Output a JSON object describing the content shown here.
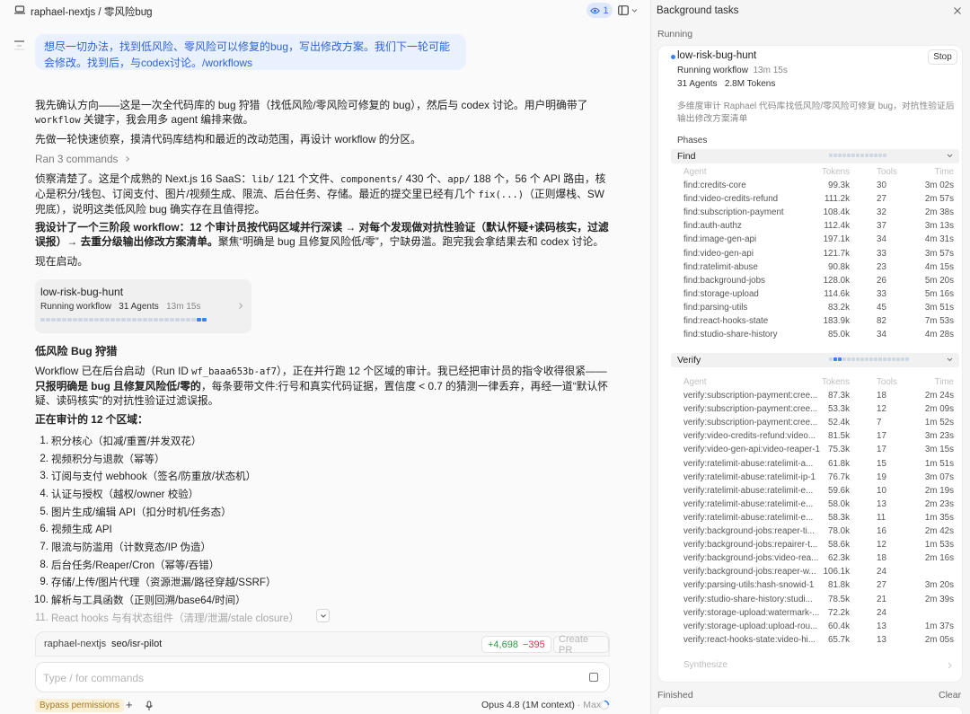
{
  "header": {
    "title": "raphael-nextjs / 零风险bug",
    "agent_count": "1"
  },
  "chat": {
    "user_message": "想尽一切办法，找到低风险、零风险可以修复的bug，写出修改方案。我们下一轮可能会修改。找到后，与codex讨论。/workflows",
    "p1_a": "我先确认方向——这是一次全代码库的 bug 狩猎（找低风险/零风险可修复的 bug），然后与 codex 讨论。用户明确带了 ",
    "p1_code": "workflow",
    "p1_b": " 关键字，我会用多 agent 编排来做。",
    "p2": "先做一轮快速侦察，摸清代码库结构和最近的改动范围，再设计 workflow 的分区。",
    "ran_commands": "Ran 3 commands",
    "p3_a": "侦察清楚了。这是个成熟的 Next.js 16 SaaS：",
    "p3_code1": "lib/",
    "p3_b": " 121 个文件、",
    "p3_code2": "components/",
    "p3_c": " 430 个、",
    "p3_code3": "app/",
    "p3_d": " 188 个，56 个 API 路由，核心是积分/钱包、订阅支付、图片/视频生成、限流、后台任务、存储。最近的提交里已经有几个 ",
    "p3_code4": "fix(...)",
    "p3_e": "（正则爆栈、SW 兜底），说明这类低风险 bug 确实存在且值得挖。",
    "p4_a": "我设计了一个三阶段 workflow：12 个审计员按代码区域并行深读 → 对每个发现做对抗性验证（默认怀疑+读码核实，过滤误报）→ 去重分级输出修改方案清单。",
    "p4_b": "聚焦“明确是 bug 且修复风险低/零”，宁缺毋滥。跑完我会拿结果去和 codex 讨论。",
    "p5": "现在启动。",
    "workflow_card": {
      "name": "low-risk-bug-hunt",
      "status": "Running workflow",
      "agents": "31 Agents",
      "elapsed": "13m 15s",
      "dots_total": 31,
      "dots_active": [
        29,
        30
      ]
    },
    "section_title": "低风险 Bug 狩猎",
    "p6_a": "Workflow 已在后台启动（Run ID ",
    "p6_code": "wf_baaa653b-af7",
    "p6_b": "），正在并行跑 12 个区域的审计。我已经把审计员的指令收得很紧——",
    "p6_bold": "只报明确是 bug 且修复风险低/零的",
    "p6_c": "，每条要带文件:行号和真实代码证据，置信度 < 0.7 的猜测一律丢弃，再经一道“默认怀疑、读码核实”的对抗性验证过滤误报。",
    "list_title": "正在审计的 12 个区域：",
    "areas": [
      "积分核心（扣减/重置/并发双花）",
      "视频积分与退款（幂等）",
      "订阅与支付 webhook（签名/防重放/状态机）",
      "认证与授权（越权/owner 校验）",
      "图片生成/编辑 API（扣分时机/任务态）",
      "视频生成 API",
      "限流与防滥用（计数竞态/IP 伪造）",
      "后台任务/Reaper/Cron（幂等/吞错）",
      "存储/上传/图片代理（资源泄漏/路径穿越/SSRF）",
      "解析与工具函数（正则回溯/base64/时间）",
      "React hooks 与有状态组件（清理/泄漏/stale closure）"
    ]
  },
  "composer": {
    "repo": "raphael-nextjs",
    "branch": "seo/isr-pilot",
    "additions": "+4,698",
    "deletions": "−395",
    "create_pr": "Create PR",
    "placeholder": "Type / for commands",
    "bypass": "Bypass permissions",
    "model": "Opus 4.8 (1M context)",
    "effort": "· Max"
  },
  "tasks_panel": {
    "title": "Background tasks",
    "running_label": "Running",
    "task": {
      "name": "low-risk-bug-hunt",
      "stop": "Stop",
      "status": "Running workflow",
      "elapsed": "13m 15s",
      "agents": "31 Agents",
      "tokens": "2.8M Tokens",
      "description": "多维度审计 Raphael 代码库找低风险/零风险可修复 bug，对抗性验证后输出修改方案清单"
    },
    "phases_label": "Phases",
    "table_headers": {
      "agent": "Agent",
      "tokens": "Tokens",
      "tools": "Tools",
      "time": "Time"
    },
    "find": {
      "label": "Find",
      "dots_total": 13,
      "rows": [
        {
          "agent": "find:credits-core",
          "tokens": "99.3k",
          "tools": "30",
          "time": "3m 02s"
        },
        {
          "agent": "find:video-credits-refund",
          "tokens": "111.2k",
          "tools": "27",
          "time": "2m 57s"
        },
        {
          "agent": "find:subscription-payment",
          "tokens": "108.4k",
          "tools": "32",
          "time": "2m 38s"
        },
        {
          "agent": "find:auth-authz",
          "tokens": "112.4k",
          "tools": "37",
          "time": "3m 13s"
        },
        {
          "agent": "find:image-gen-api",
          "tokens": "197.1k",
          "tools": "34",
          "time": "4m 31s"
        },
        {
          "agent": "find:video-gen-api",
          "tokens": "121.7k",
          "tools": "33",
          "time": "3m 57s"
        },
        {
          "agent": "find:ratelimit-abuse",
          "tokens": "90.8k",
          "tools": "23",
          "time": "4m 15s"
        },
        {
          "agent": "find:background-jobs",
          "tokens": "128.0k",
          "tools": "26",
          "time": "5m 20s"
        },
        {
          "agent": "find:storage-upload",
          "tokens": "114.6k",
          "tools": "33",
          "time": "5m 16s"
        },
        {
          "agent": "find:parsing-utils",
          "tokens": "83.2k",
          "tools": "45",
          "time": "3m 51s"
        },
        {
          "agent": "find:react-hooks-state",
          "tokens": "183.9k",
          "tools": "82",
          "time": "7m 53s"
        },
        {
          "agent": "find:studio-share-history",
          "tokens": "85.0k",
          "tools": "34",
          "time": "4m 28s"
        }
      ]
    },
    "verify": {
      "label": "Verify",
      "dots_total": 18,
      "dots_active": [
        1,
        2
      ],
      "rows": [
        {
          "agent": "verify:subscription-payment:cree...",
          "tokens": "87.3k",
          "tools": "18",
          "time": "2m 24s"
        },
        {
          "agent": "verify:subscription-payment:cree...",
          "tokens": "53.3k",
          "tools": "12",
          "time": "2m 09s"
        },
        {
          "agent": "verify:subscription-payment:cree...",
          "tokens": "52.4k",
          "tools": "7",
          "time": "1m 52s"
        },
        {
          "agent": "verify:video-credits-refund:video...",
          "tokens": "81.5k",
          "tools": "17",
          "time": "3m 23s"
        },
        {
          "agent": "verify:video-gen-api:video-reaper-1",
          "tokens": "75.3k",
          "tools": "17",
          "time": "3m 15s"
        },
        {
          "agent": "verify:ratelimit-abuse:ratelimit-a...",
          "tokens": "61.8k",
          "tools": "15",
          "time": "1m 51s"
        },
        {
          "agent": "verify:ratelimit-abuse:ratelimit-ip-1",
          "tokens": "76.7k",
          "tools": "19",
          "time": "3m 07s"
        },
        {
          "agent": "verify:ratelimit-abuse:ratelimit-e...",
          "tokens": "59.6k",
          "tools": "10",
          "time": "2m 19s"
        },
        {
          "agent": "verify:ratelimit-abuse:ratelimit-e...",
          "tokens": "58.0k",
          "tools": "13",
          "time": "2m 23s"
        },
        {
          "agent": "verify:ratelimit-abuse:ratelimit-e...",
          "tokens": "58.3k",
          "tools": "11",
          "time": "1m 35s"
        },
        {
          "agent": "verify:background-jobs:reaper-ti...",
          "tokens": "78.0k",
          "tools": "16",
          "time": "2m 42s"
        },
        {
          "agent": "verify:background-jobs:repairer-t...",
          "tokens": "58.6k",
          "tools": "12",
          "time": "1m 53s"
        },
        {
          "agent": "verify:background-jobs:video-rea...",
          "tokens": "62.3k",
          "tools": "18",
          "time": "2m 16s"
        },
        {
          "agent": "verify:background-jobs:reaper-w...",
          "tokens": "106.1k",
          "tools": "24",
          "time": ""
        },
        {
          "agent": "verify:parsing-utils:hash-snowid-1",
          "tokens": "81.8k",
          "tools": "27",
          "time": "3m 20s"
        },
        {
          "agent": "verify:studio-share-history:studi...",
          "tokens": "78.5k",
          "tools": "21",
          "time": "2m 39s"
        },
        {
          "agent": "verify:storage-upload:watermark-...",
          "tokens": "72.2k",
          "tools": "24",
          "time": ""
        },
        {
          "agent": "verify:storage-upload:upload-rou...",
          "tokens": "60.4k",
          "tools": "13",
          "time": "1m 37s"
        },
        {
          "agent": "verify:react-hooks-state:video-hi...",
          "tokens": "65.7k",
          "tools": "13",
          "time": "2m 05s"
        }
      ]
    },
    "synthesize": {
      "label": "Synthesize"
    },
    "finished_label": "Finished",
    "clear_label": "Clear"
  },
  "colors": {
    "accent": "#3b82f6",
    "user_bubble_bg": "#eaf1fe",
    "user_bubble_text": "#2d63d9",
    "additions": "#2e9a4a",
    "deletions": "#d3394a",
    "bypass_bg": "#fbf0d6"
  }
}
